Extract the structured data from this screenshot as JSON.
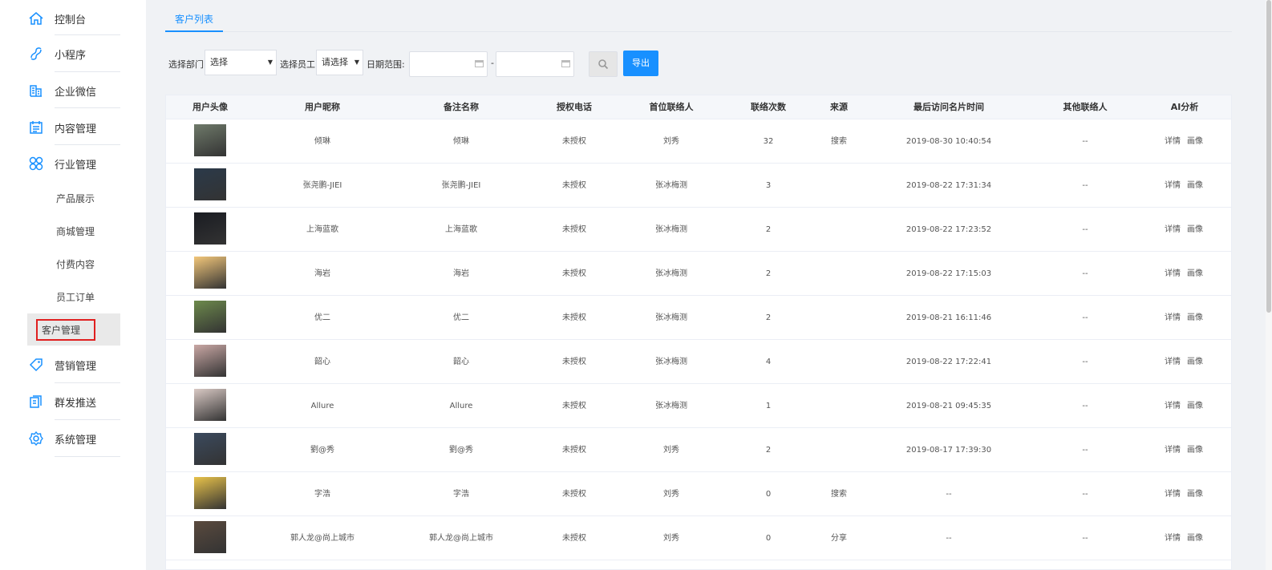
{
  "sidebar": {
    "items": [
      {
        "label": "控制台",
        "icon": "home-icon"
      },
      {
        "label": "小程序",
        "icon": "miniprogram-icon"
      },
      {
        "label": "企业微信",
        "icon": "wecom-icon"
      },
      {
        "label": "内容管理",
        "icon": "content-icon"
      },
      {
        "label": "行业管理",
        "icon": "industry-icon"
      },
      {
        "label": "营销管理",
        "icon": "marketing-icon"
      },
      {
        "label": "群发推送",
        "icon": "broadcast-icon"
      },
      {
        "label": "系统管理",
        "icon": "settings-icon"
      }
    ],
    "subitems": [
      {
        "label": "产品展示"
      },
      {
        "label": "商城管理"
      },
      {
        "label": "付费内容"
      },
      {
        "label": "员工订单"
      },
      {
        "label": "客户管理",
        "active": true
      }
    ]
  },
  "tab": {
    "label": "客户列表"
  },
  "filters": {
    "dept_label": "选择部门:",
    "dept_value": "选择",
    "staff_label": "选择员工:",
    "staff_value": "请选择",
    "date_label": "日期范围:",
    "date_sep": "-",
    "export_label": "导出"
  },
  "table": {
    "columns": [
      "用户头像",
      "用户昵称",
      "备注名称",
      "授权电话",
      "首位联络人",
      "联络次数",
      "来源",
      "最后访问名片时间",
      "其他联络人",
      "AI分析"
    ],
    "actions": {
      "detail": "详情",
      "portrait": "画像"
    },
    "rows": [
      {
        "nickname": "倾琳",
        "remark": "倾琳",
        "phone": "未授权",
        "contact": "刘秀",
        "count": "32",
        "source": "搜索",
        "last_visit": "2019-08-30 10:40:54",
        "others": "--",
        "avatar_color": "#6f7a6a"
      },
      {
        "nickname": "张尧鹏-JIEI",
        "remark": "张尧鹏-JIEI",
        "phone": "未授权",
        "contact": "张冰梅测",
        "count": "3",
        "source": "",
        "last_visit": "2019-08-22 17:31:34",
        "others": "--",
        "avatar_color": "#2b3a4a"
      },
      {
        "nickname": "上海蓝歌",
        "remark": "上海蓝歌",
        "phone": "未授权",
        "contact": "张冰梅测",
        "count": "2",
        "source": "",
        "last_visit": "2019-08-22 17:23:52",
        "others": "--",
        "avatar_color": "#1a1c22"
      },
      {
        "nickname": "海岩",
        "remark": "海岩",
        "phone": "未授权",
        "contact": "张冰梅测",
        "count": "2",
        "source": "",
        "last_visit": "2019-08-22 17:15:03",
        "others": "--",
        "avatar_color": "#f3c77a"
      },
      {
        "nickname": "优二",
        "remark": "优二",
        "phone": "未授权",
        "contact": "张冰梅测",
        "count": "2",
        "source": "",
        "last_visit": "2019-08-21 16:11:46",
        "others": "--",
        "avatar_color": "#6d8a4c"
      },
      {
        "nickname": "韶心",
        "remark": "韶心",
        "phone": "未授权",
        "contact": "张冰梅测",
        "count": "4",
        "source": "",
        "last_visit": "2019-08-22 17:22:41",
        "others": "--",
        "avatar_color": "#c9a7a4"
      },
      {
        "nickname": "Allure",
        "remark": "Allure",
        "phone": "未授权",
        "contact": "张冰梅测",
        "count": "1",
        "source": "",
        "last_visit": "2019-08-21 09:45:35",
        "others": "--",
        "avatar_color": "#d9c9c4"
      },
      {
        "nickname": "劉@秀",
        "remark": "劉@秀",
        "phone": "未授权",
        "contact": "刘秀",
        "count": "2",
        "source": "",
        "last_visit": "2019-08-17 17:39:30",
        "others": "--",
        "avatar_color": "#3b4a5e"
      },
      {
        "nickname": "字浩",
        "remark": "字浩",
        "phone": "未授权",
        "contact": "刘秀",
        "count": "0",
        "source": "搜索",
        "last_visit": "--",
        "others": "--",
        "avatar_color": "#e8c24a"
      },
      {
        "nickname": "郭人龙@尚上城市",
        "remark": "郭人龙@尚上城市",
        "phone": "未授权",
        "contact": "刘秀",
        "count": "0",
        "source": "分享",
        "last_visit": "--",
        "others": "--",
        "avatar_color": "#5a4a3e"
      }
    ]
  },
  "colors": {
    "accent": "#1890ff",
    "highlight": "#e02020"
  }
}
